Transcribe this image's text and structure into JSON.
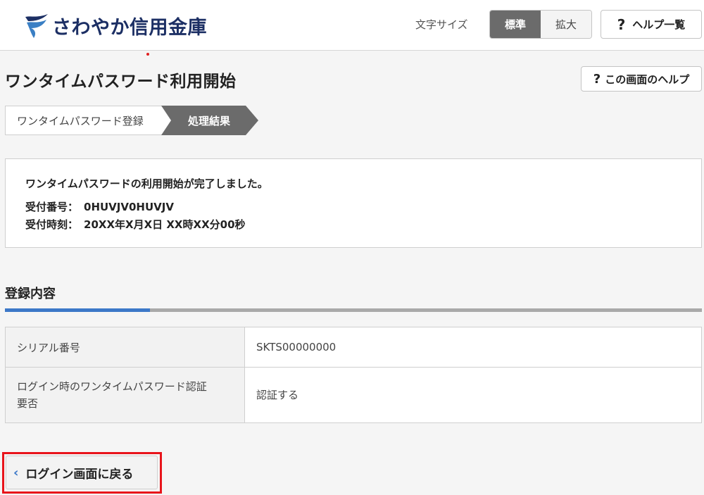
{
  "header": {
    "logo_text": "さわやか信用金庫",
    "font_size_label": "文字サイズ",
    "font_size_standard": "標準",
    "font_size_large": "拡大",
    "help_list_label": "ヘルプ一覧",
    "help_icon": "?"
  },
  "page": {
    "title": "ワンタイムパスワード利用開始",
    "screen_help_label": "この画面のヘルプ"
  },
  "steps": [
    {
      "label": "ワンタイムパスワード登録",
      "active": false
    },
    {
      "label": "処理結果",
      "active": true
    }
  ],
  "result": {
    "message": "ワンタイムパスワードの利用開始が完了しました。",
    "receipt_no_label": "受付番号：",
    "receipt_no_value": "0HUVJV0HUVJV",
    "receipt_time_label": "受付時刻：",
    "receipt_time_value": "20XX年X月X日 XX時XX分00秒"
  },
  "registration": {
    "section_title": "登録内容",
    "rows": [
      {
        "label": "シリアル番号",
        "value": "SKTS00000000"
      },
      {
        "label_line1": "ログイン時のワンタイムパスワード認証",
        "label_line2": "要否",
        "value": "認証する"
      }
    ]
  },
  "back_button": {
    "label": "ログイン画面に戻る",
    "icon": "chevron-left-icon"
  },
  "colors": {
    "brand": "#1c2f64",
    "accent_blue": "#3c78c8",
    "highlight_red": "#e8141b",
    "active_step": "#6b6b6b"
  }
}
